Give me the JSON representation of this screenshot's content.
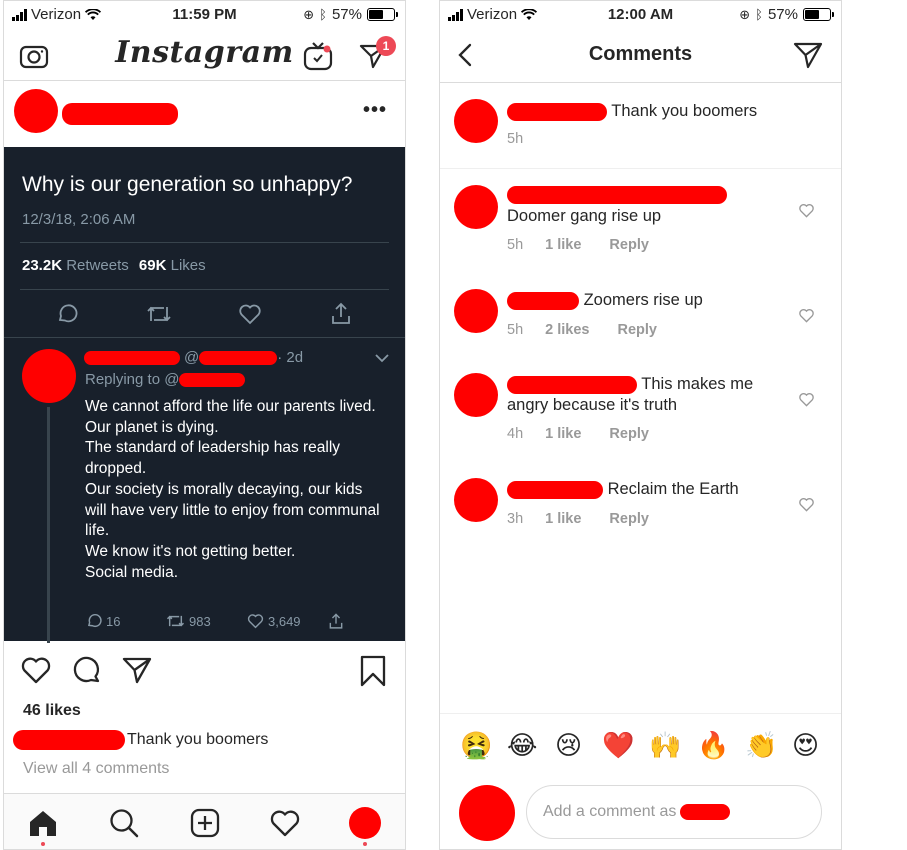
{
  "left": {
    "status": {
      "carrier": "Verizon",
      "time": "11:59 PM",
      "battery": "57%"
    },
    "header": {
      "logo": "Instagram",
      "dm_badge": "1"
    },
    "tweet": {
      "title": "Why is our generation so unhappy?",
      "date": "12/3/18, 2:06 AM",
      "retweets_count": "23.2K",
      "retweets_label": "Retweets",
      "likes_count": "69K",
      "likes_label": "Likes"
    },
    "reply": {
      "at": "@",
      "age": "· 2d",
      "replying_to": "Replying to @",
      "lines": [
        "We cannot afford the life our parents lived.",
        "Our planet is dying.",
        "The standard of leadership has really dropped.",
        "Our society is morally decaying, our kids will have very little to enjoy from communal life.",
        "We know it's not getting better.",
        "Social media."
      ],
      "replies": "16",
      "retweets": "983",
      "likes": "3,649"
    },
    "post": {
      "likes": "46 likes",
      "caption": "Thank you boomers",
      "view_all": "View all 4 comments"
    }
  },
  "right": {
    "status": {
      "carrier": "Verizon",
      "time": "12:00 AM",
      "battery": "57%"
    },
    "title": "Comments",
    "caption": {
      "text": "Thank you boomers",
      "time": "5h"
    },
    "comments": [
      {
        "text": "Doomer gang rise up",
        "time": "5h",
        "likes": "1 like",
        "reply": "Reply"
      },
      {
        "text": "Zoomers rise up",
        "time": "5h",
        "likes": "2 likes",
        "reply": "Reply"
      },
      {
        "text": "This makes me",
        "text2": "angry because it's truth",
        "time": "4h",
        "likes": "1 like",
        "reply": "Reply"
      },
      {
        "text": "Reclaim the Earth",
        "time": "3h",
        "likes": "1 like",
        "reply": "Reply"
      }
    ],
    "emojis": [
      "🤮",
      "😂",
      "😢",
      "❤️",
      "🙌",
      "🔥",
      "👏",
      "😍"
    ],
    "input_placeholder": "Add a comment as"
  },
  "colors": {
    "tweet_bg": "#18202b",
    "redaction": "#ff0000",
    "badge": "#ed4956",
    "link_blue": "#1da1f2"
  },
  "icons": [
    "camera-icon",
    "igtv-icon",
    "direct-icon",
    "more-icon",
    "comment-icon",
    "retweet-icon",
    "heart-icon",
    "share-icon",
    "bookmark-icon",
    "home-icon",
    "search-icon",
    "add-icon",
    "back-icon",
    "chevron-down-icon"
  ]
}
